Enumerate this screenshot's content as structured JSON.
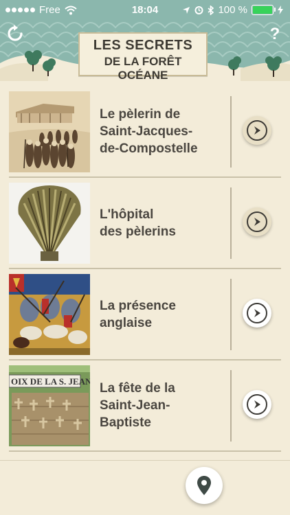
{
  "status_bar": {
    "carrier": "Free",
    "time": "18:04",
    "battery": "100 %"
  },
  "header": {
    "title_line1": "LES SECRETS",
    "title_line2": "DE LA FORÊT OCÉANE",
    "reload_icon": "reload-icon",
    "help_label": "?"
  },
  "items": [
    {
      "label": "Le pèlerin de\nSaint-Jacques-\nde-Compostelle",
      "image": "pilgrims-sketch",
      "arrow": "faded"
    },
    {
      "label": "L'hôpital\ndes pèlerins",
      "image": "scallop-shell",
      "arrow": "faded"
    },
    {
      "label": "La présence\nanglaise",
      "image": "medieval-battle",
      "arrow": "active"
    },
    {
      "label": "La fête de la\nSaint-Jean-\nBaptiste",
      "image": "saint-jean-crosses",
      "arrow": "active"
    }
  ],
  "sign_text": "OIX DE LA S. JEAN",
  "map_button_icon": "map-pin-icon",
  "colors": {
    "header_bg": "#8bb7ad",
    "page_bg": "#f3ecd9",
    "text": "#4a4640"
  }
}
